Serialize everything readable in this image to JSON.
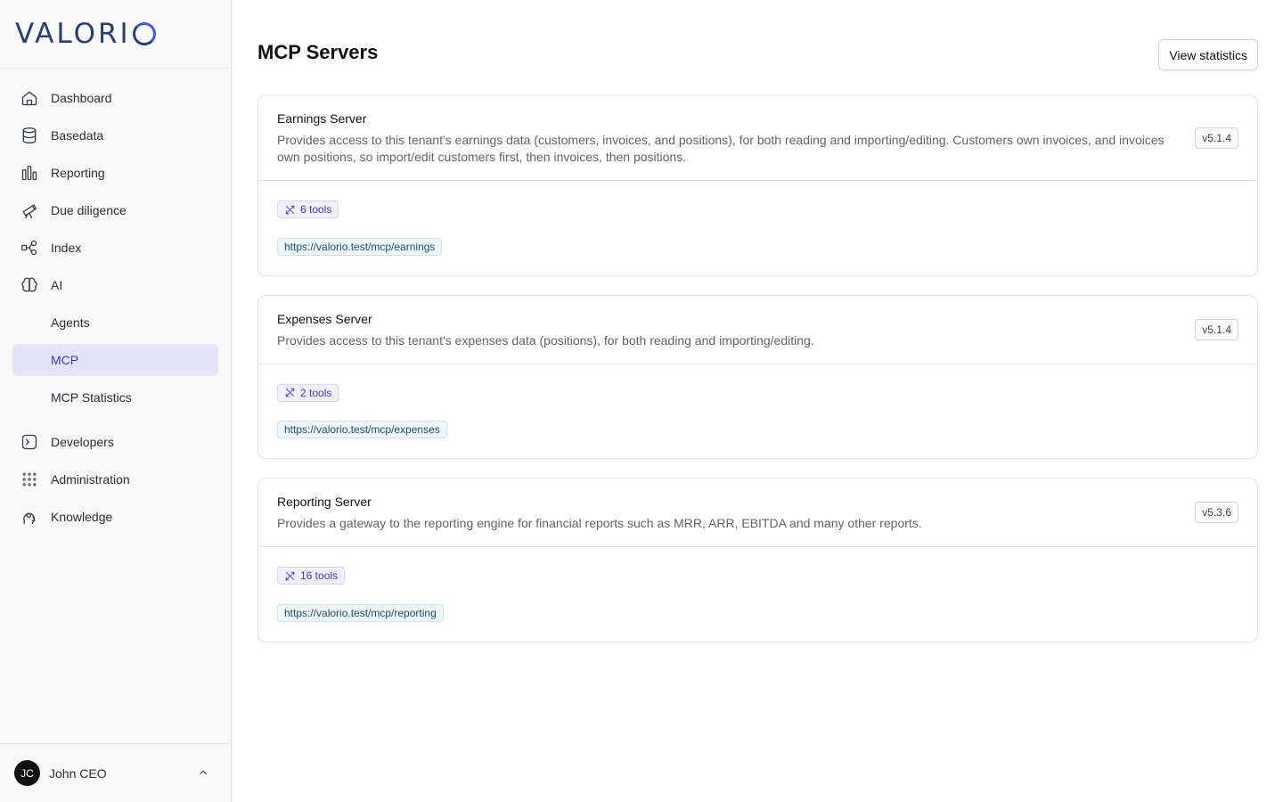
{
  "brand": {
    "logo_text": "VALORI"
  },
  "sidebar": {
    "items": [
      {
        "label": "Dashboard",
        "icon": "home-icon"
      },
      {
        "label": "Basedata",
        "icon": "database-icon"
      },
      {
        "label": "Reporting",
        "icon": "bar-chart-icon"
      },
      {
        "label": "Due diligence",
        "icon": "telescope-icon"
      },
      {
        "label": "Index",
        "icon": "network-icon"
      },
      {
        "label": "AI",
        "icon": "brain-icon"
      },
      {
        "label": "Agents"
      },
      {
        "label": "MCP",
        "active": true
      },
      {
        "label": "MCP Statistics"
      },
      {
        "label": "Developers",
        "icon": "terminal-icon"
      },
      {
        "label": "Administration",
        "icon": "grid-dots-icon"
      },
      {
        "label": "Knowledge",
        "icon": "head-icon"
      }
    ]
  },
  "user": {
    "initials": "JC",
    "name": "John CEO"
  },
  "page": {
    "title": "MCP Servers",
    "view_statistics_label": "View statistics"
  },
  "servers": [
    {
      "name": "Earnings Server",
      "description": "Provides access to this tenant's earnings data (customers, invoices, and positions), for both reading and importing/editing. Customers own invoices, and invoices own positions, so import/edit customers first, then invoices, then positions.",
      "version": "v5.1.4",
      "tools": "6 tools",
      "url": "https://valorio.test/mcp/earnings"
    },
    {
      "name": "Expenses Server",
      "description": "Provides access to this tenant's expenses data (positions), for both reading and importing/editing.",
      "version": "v5.1.4",
      "tools": "2 tools",
      "url": "https://valorio.test/mcp/expenses"
    },
    {
      "name": "Reporting Server",
      "description": "Provides a gateway to the reporting engine for financial reports such as MRR, ARR, EBITDA and many other reports.",
      "version": "v5.3.6",
      "tools": "16 tools",
      "url": "https://valorio.test/mcp/reporting"
    }
  ],
  "colors": {
    "accent": "#4338ca",
    "active_bg": "#e4e3f5",
    "url_badge_bg": "#eef6fb"
  }
}
